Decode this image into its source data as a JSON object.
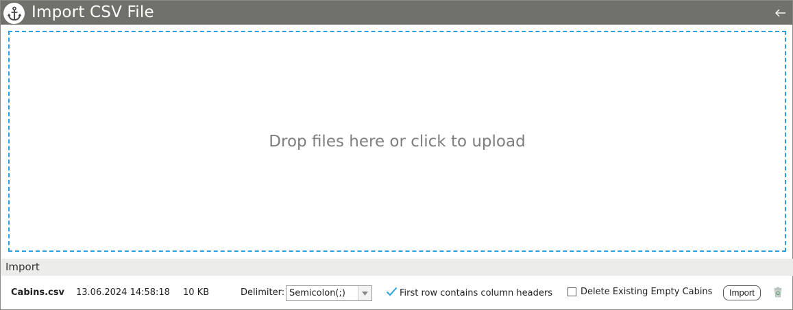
{
  "window": {
    "title": "Import CSV File",
    "icons": {
      "logo": "anchor-icon",
      "back": "arrow-left-icon"
    }
  },
  "dropzone": {
    "text": "Drop files here or click to upload",
    "border_color": "#2ba0e0"
  },
  "import_section": {
    "header": "Import",
    "file": {
      "name": "Cabins.csv",
      "date": "13.06.2024 14:58:18",
      "size": "10 KB"
    },
    "delimiter": {
      "label": "Delimiter:",
      "selected": "Semicolon(;)"
    },
    "first_row_headers": {
      "label": "First row contains column headers",
      "checked": true
    },
    "delete_existing": {
      "label": "Delete Existing Empty Cabins",
      "checked": false
    },
    "import_button": "Import",
    "delete_icon": "trash-icon"
  },
  "colors": {
    "titlebar": "#71716b",
    "accent": "#2ba0e0",
    "section_header_bg": "#ececea"
  }
}
